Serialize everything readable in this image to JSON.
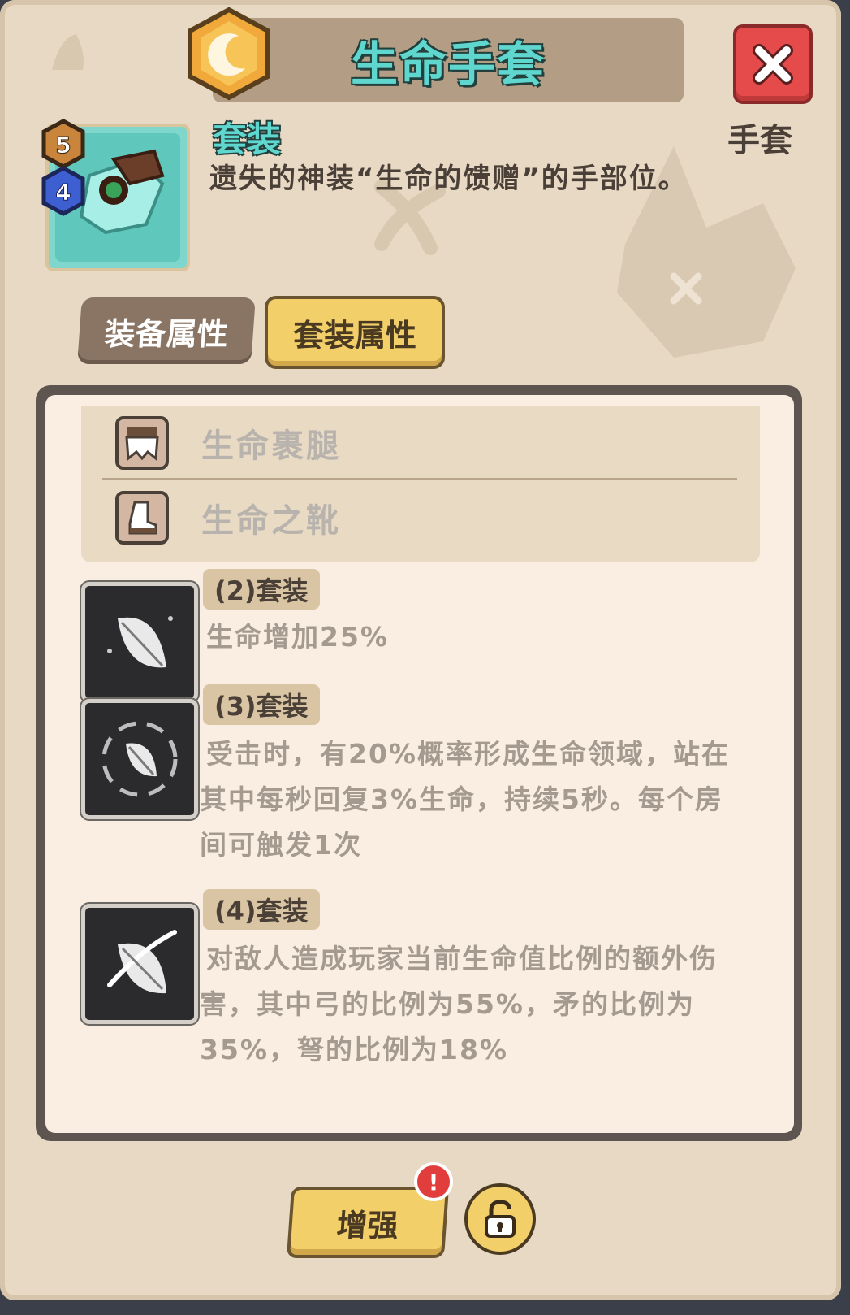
{
  "header": {
    "title": "生命手套"
  },
  "item": {
    "set_label": "套装",
    "slot": "手套",
    "description": "遗失的神装“生命的馈赠”的手部位。",
    "level_top": "5",
    "level_bottom": "4"
  },
  "tabs": [
    {
      "label": "装备属性",
      "active": false
    },
    {
      "label": "套装属性",
      "active": true
    }
  ],
  "locked_items": [
    {
      "name": "生命裹腿",
      "icon": "leg-armor-icon"
    },
    {
      "name": "生命之靴",
      "icon": "boot-icon"
    }
  ],
  "set_bonuses": [
    {
      "tag": "(2)套装",
      "lines": [
        "生命增加25%"
      ],
      "icon": "leaf-icon"
    },
    {
      "tag": "(3)套装",
      "lines": [
        "受击时，有20%概率形成生命领域，站在",
        "其中每秒回复3%生命，持续5秒。每个房",
        "间可触发1次"
      ],
      "icon": "leaf-ring-icon"
    },
    {
      "tag": "(4)套装",
      "lines": [
        "对敌人造成玩家当前生命值比例的额外伤",
        "害，其中弓的比例为55%，矛的比例为",
        "35%，弩的比例为18%"
      ],
      "icon": "leaf-slash-icon"
    }
  ],
  "footer": {
    "enhance_label": "增强",
    "alert": "!"
  },
  "colors": {
    "accent_teal": "#5fd7cf",
    "button_gold": "#f3cf6a",
    "close_red": "#e54b4b"
  }
}
